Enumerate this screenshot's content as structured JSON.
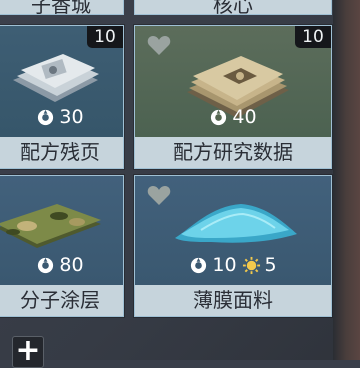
{
  "top_row": [
    {
      "label": "子香城"
    },
    {
      "label": "核心"
    }
  ],
  "cards": [
    {
      "name": "配方残页",
      "count": "10",
      "favorite": false,
      "costs": [
        {
          "icon": "gear-icon",
          "value": "30"
        }
      ]
    },
    {
      "name": "配方研究数据",
      "count": "10",
      "favorite": true,
      "costs": [
        {
          "icon": "gear-icon",
          "value": "40"
        }
      ]
    },
    {
      "name": "分子涂层",
      "count": "",
      "favorite": false,
      "costs": [
        {
          "icon": "gear-icon",
          "value": "80"
        }
      ]
    },
    {
      "name": "薄膜面料",
      "count": "",
      "favorite": true,
      "costs": [
        {
          "icon": "gear-icon",
          "value": "10"
        },
        {
          "icon": "sun-icon",
          "value": "5"
        }
      ]
    }
  ],
  "add_button_label": "+"
}
